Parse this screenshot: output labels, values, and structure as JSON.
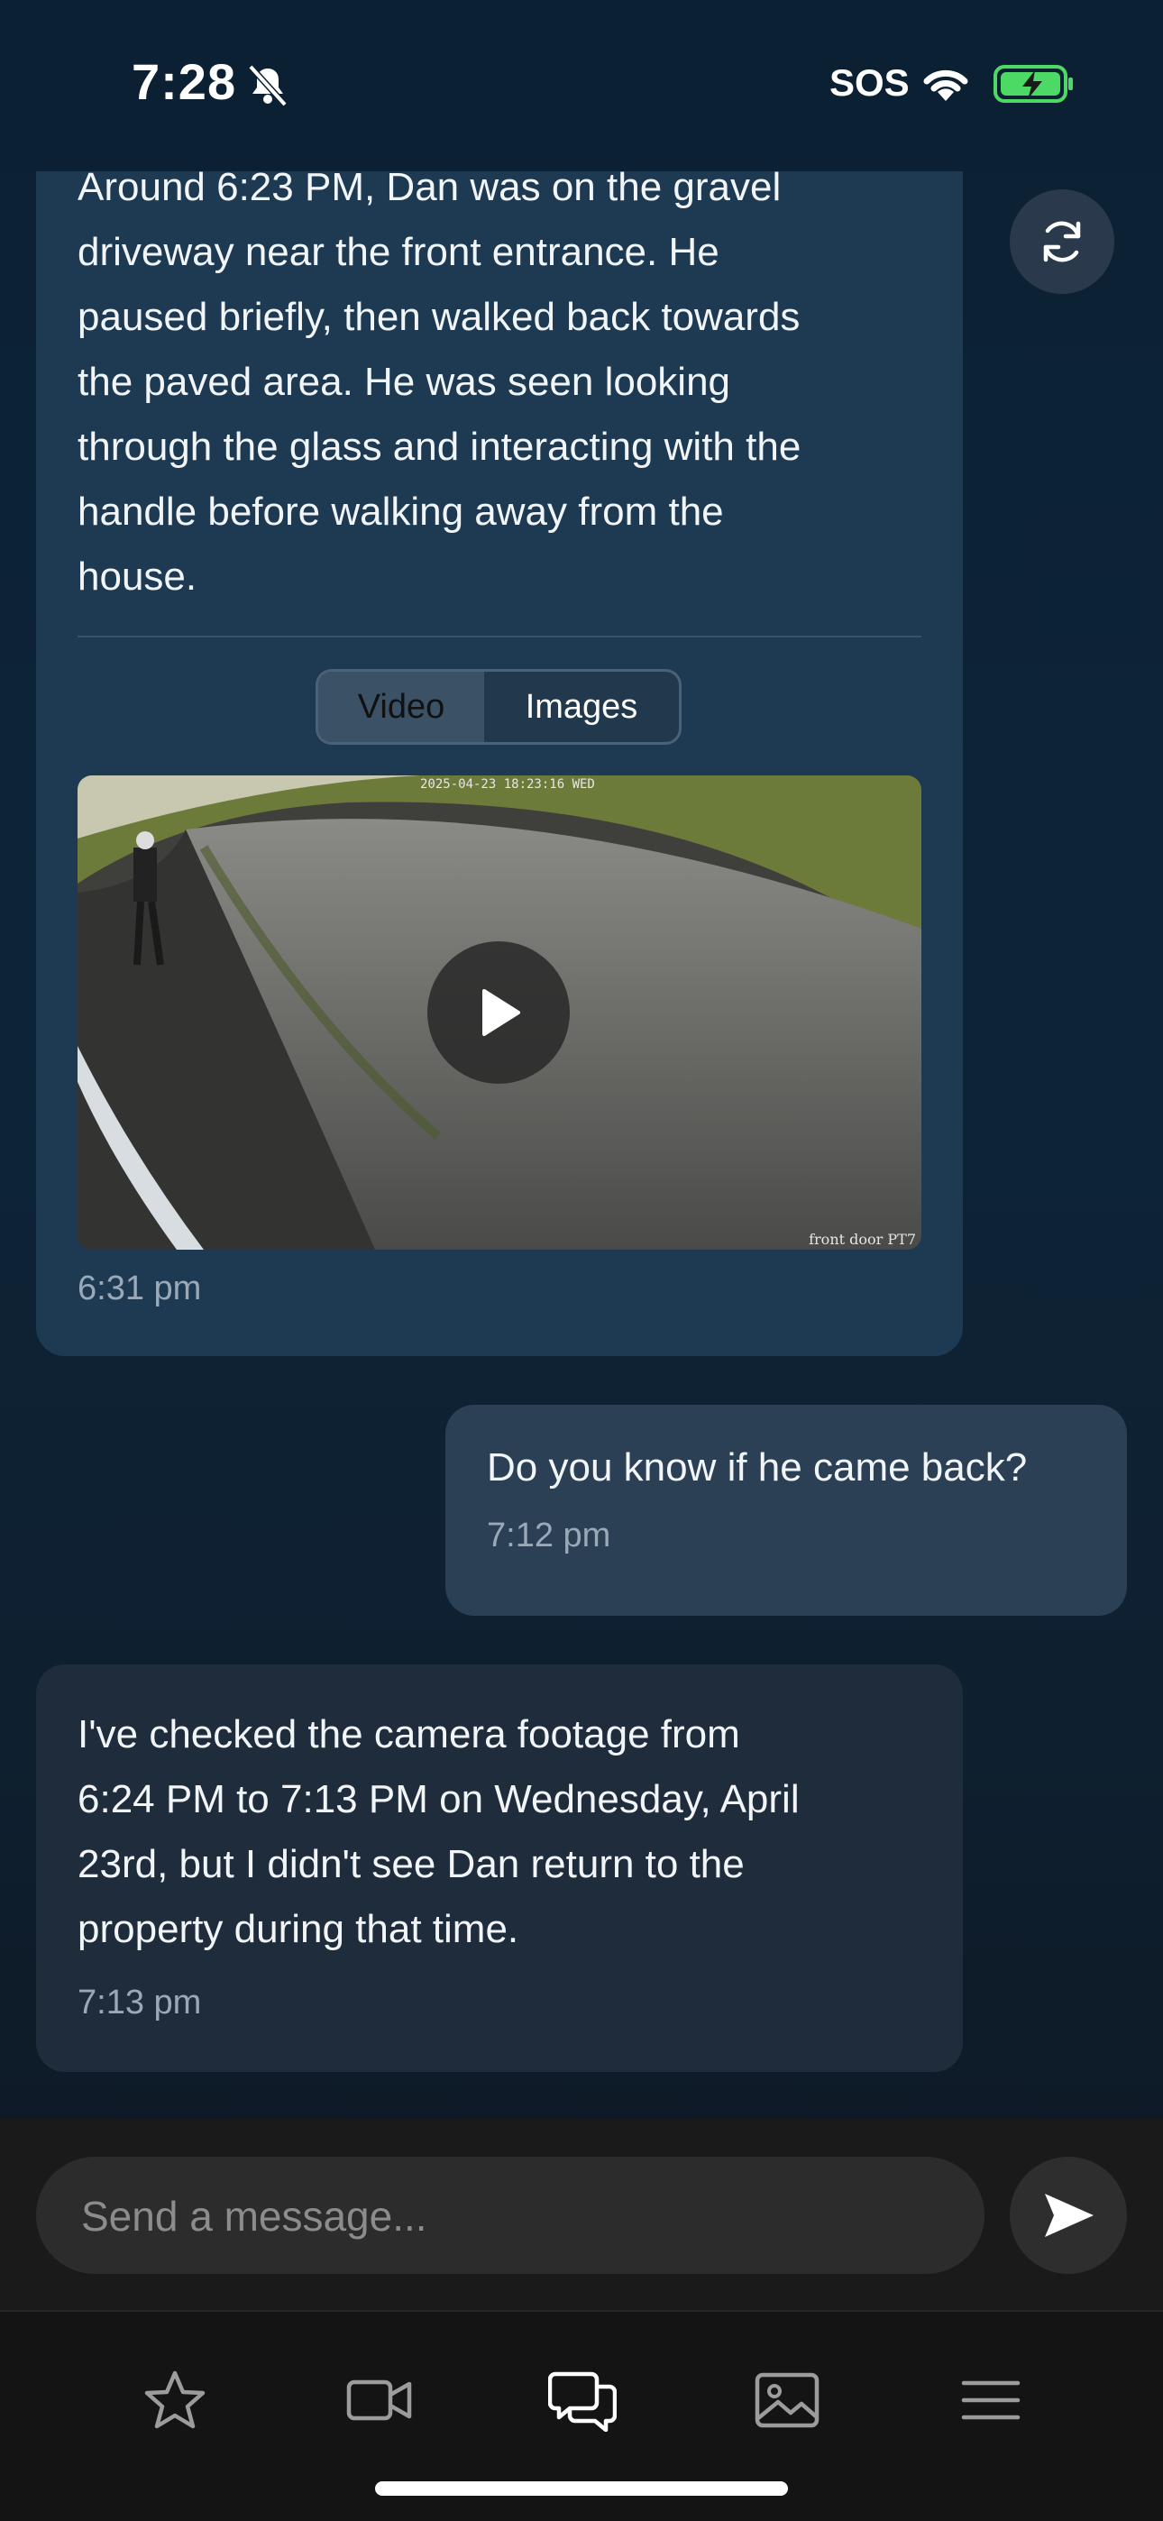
{
  "status_bar": {
    "time": "7:28",
    "carrier": "SOS"
  },
  "messages": {
    "ai_first": {
      "text_lines": [
        "Around 6:23 PM, Dan was on the gravel",
        "driveway near the front entrance. He",
        "paused briefly, then walked back towards",
        "the paved area. He was seen looking",
        "through the glass and interacting with the",
        "handle before walking away from the",
        "house."
      ],
      "time": "6:31 pm",
      "media_tabs": {
        "video": "Video",
        "images": "Images",
        "selected": "Video"
      },
      "video_overlay": {
        "timestamp": "2025-04-23 18:23:16 WED",
        "camera_label": "front door PT7"
      }
    },
    "user": {
      "text": "Do you know if he came back?",
      "time": "7:12 pm"
    },
    "ai_second": {
      "text_lines": [
        "I've checked the camera footage from",
        "6:24 PM to 7:13 PM on Wednesday, April",
        "23rd, but I didn't see Dan return to the",
        "property during that time."
      ],
      "time": "7:13 pm"
    }
  },
  "composer": {
    "placeholder": "Send a message..."
  },
  "tabbar": {
    "items": [
      "star-icon",
      "video-camera-icon",
      "chat-icon",
      "gallery-icon",
      "menu-icon"
    ],
    "active": "chat-icon"
  },
  "colors": {
    "ai_bubble": "#1e3a52",
    "user_bubble": "#2b4054",
    "battery_green": "#4cd964"
  }
}
